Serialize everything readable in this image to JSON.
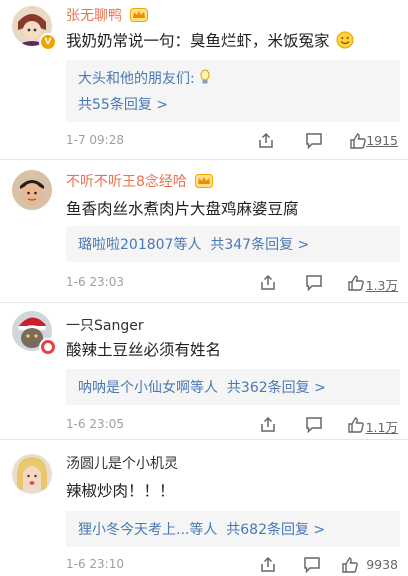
{
  "comments": [
    {
      "user": "张无聊鸭",
      "text": "我奶奶常说一句：臭鱼烂虾，米饭冤家",
      "reply_link": "大头和他的朋友们:",
      "reply_count": "共55条回复 >",
      "time": "1-7 09:28",
      "likes": "1915"
    },
    {
      "user": "不听不听王8念经哈",
      "text": "鱼香肉丝水煮肉片大盘鸡麻婆豆腐",
      "reply_link": "璐啦啦201807等人",
      "reply_count": "共347条回复 >",
      "time": "1-6 23:03",
      "likes": "1.3万"
    },
    {
      "user": "一只Sanger",
      "text": "酸辣土豆丝必须有姓名",
      "reply_link": "呐呐是个小仙女啊等人",
      "reply_count": "共362条回复 >",
      "time": "1-6 23:05",
      "likes": "1.1万"
    },
    {
      "user": "汤圆儿是个小机灵",
      "text": "辣椒炒肉！！！",
      "reply_link": "狸小冬今天考上...等人",
      "reply_count": "共682条回复 >",
      "time": "1-6 23:10",
      "likes": "9938"
    }
  ],
  "icons": {
    "crown": "crown-icon",
    "smiley": "smiley-icon",
    "lightbulb": "lightbulb-icon",
    "share": "share-icon",
    "comment": "comment-icon",
    "like": "thumbs-up-icon"
  },
  "colors": {
    "vip_name": "#eb7350",
    "link": "#4a78b4",
    "time": "#a0a0a0"
  }
}
